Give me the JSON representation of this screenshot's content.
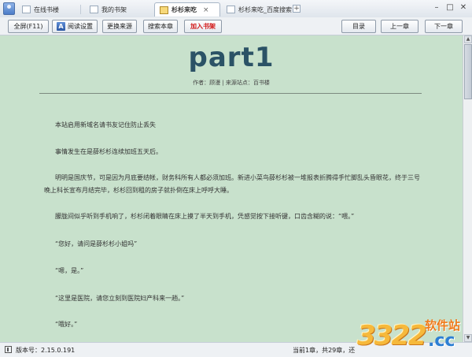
{
  "tabs": [
    {
      "label": "在线书楼",
      "icon": "book-shelf-icon"
    },
    {
      "label": "我的书架",
      "icon": "bookshelf-icon"
    },
    {
      "label": "杉杉来吃",
      "icon": "book-icon",
      "active": true,
      "close": "×"
    },
    {
      "label": "杉杉来吃_百度搜索",
      "icon": "page-icon"
    }
  ],
  "new_tab_symbol": "+",
  "window_controls": {
    "minimize": "–",
    "maximize": "□",
    "close": "✕"
  },
  "toolbar": {
    "fullscreen_label": "全屏(F11)",
    "reading_settings_label": "阅读设置",
    "change_source_label": "更换来源",
    "search_chapter_label": "搜索本章",
    "add_to_shelf_label": "加入书架",
    "toc_label": "目录",
    "prev_chapter_label": "上一章",
    "next_chapter_label": "下一章"
  },
  "chapter": {
    "title": "part1",
    "meta": "作者：顾漫 | 来源站点：百书楼",
    "paragraphs": [
      "本站启用新域名请书友记住防止丢失",
      "事情发生在是薛杉杉连续加班五天后。",
      "明明是国庆节，可是因为月底要结帐，财务科所有人都必须加班。新进小菜鸟薛杉杉被一堆报表折腾得手忙脚乱头昏眼花，终于三号晚上科长宣布月结完毕，杉杉回到租的房子就扑倒在床上呼呼大睡。",
      "朦胧间似乎听到手机响了，杉杉闭着眼睛在床上摸了半天到手机，凭感觉按下接听键，口齿含糊的说：“喂。”",
      "“您好，请问是薛杉杉小姐吗”",
      "“嗯，是。”",
      "“这里是医院，请您立刻到医院妇产科来一趟。”",
      "“哦好。”"
    ]
  },
  "status": {
    "version": "版本号：2.15.0.191",
    "progress": "当前1章，共29章，还"
  },
  "watermark": {
    "number": "3322",
    "brand": "软件站",
    "domain": ".cc"
  },
  "colors": {
    "reading_background": "#c8e1cc",
    "title": "#2b5266",
    "add_to_shelf": "#d21515"
  }
}
